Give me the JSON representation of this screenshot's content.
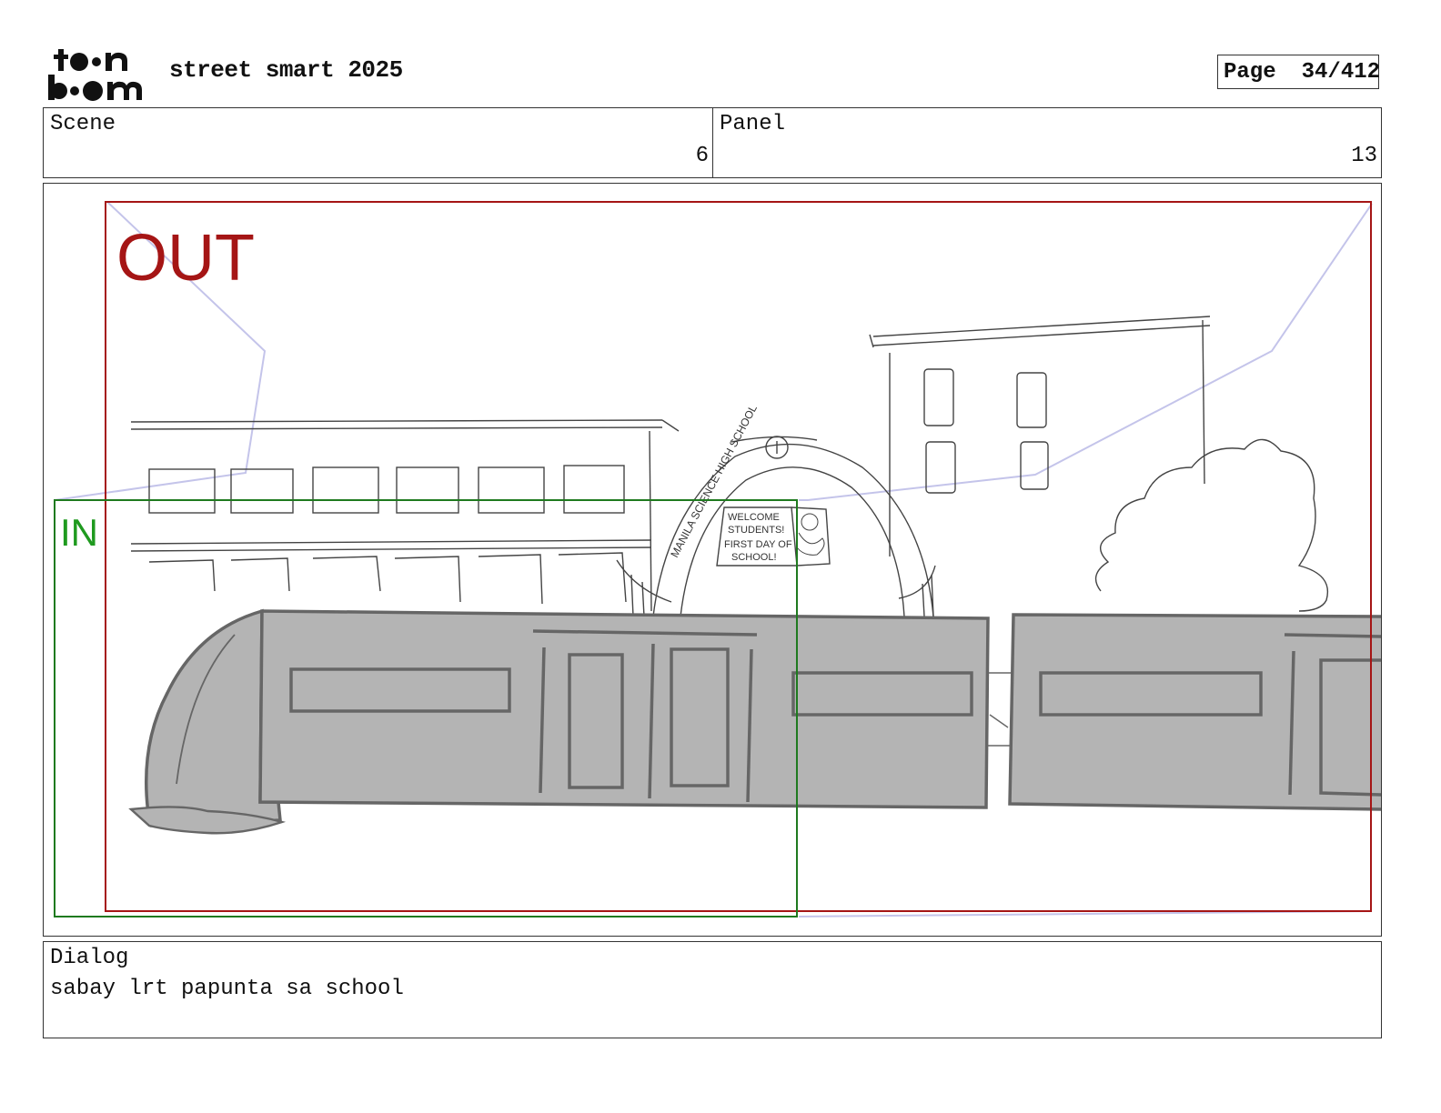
{
  "header": {
    "logo_text": "toonboom",
    "project_title": "street smart 2025",
    "page_label": "Page",
    "page_number": "34/412"
  },
  "info": {
    "scene_label": "Scene",
    "scene_value": "6",
    "panel_label": "Panel",
    "panel_value": "13"
  },
  "frame": {
    "out_label": "OUT",
    "in_label": "IN",
    "out_color": "#a51515",
    "in_color": "#1f7a1f",
    "sign": {
      "arch_text": "MANILA SCIENCE HIGH SCHOOL",
      "banner_lines": [
        "WELCOME",
        "STUDENTS!",
        "FIRST DAY OF",
        "SCHOOL!"
      ]
    }
  },
  "dialog": {
    "label": "Dialog",
    "text": "sabay lrt papunta sa school"
  }
}
